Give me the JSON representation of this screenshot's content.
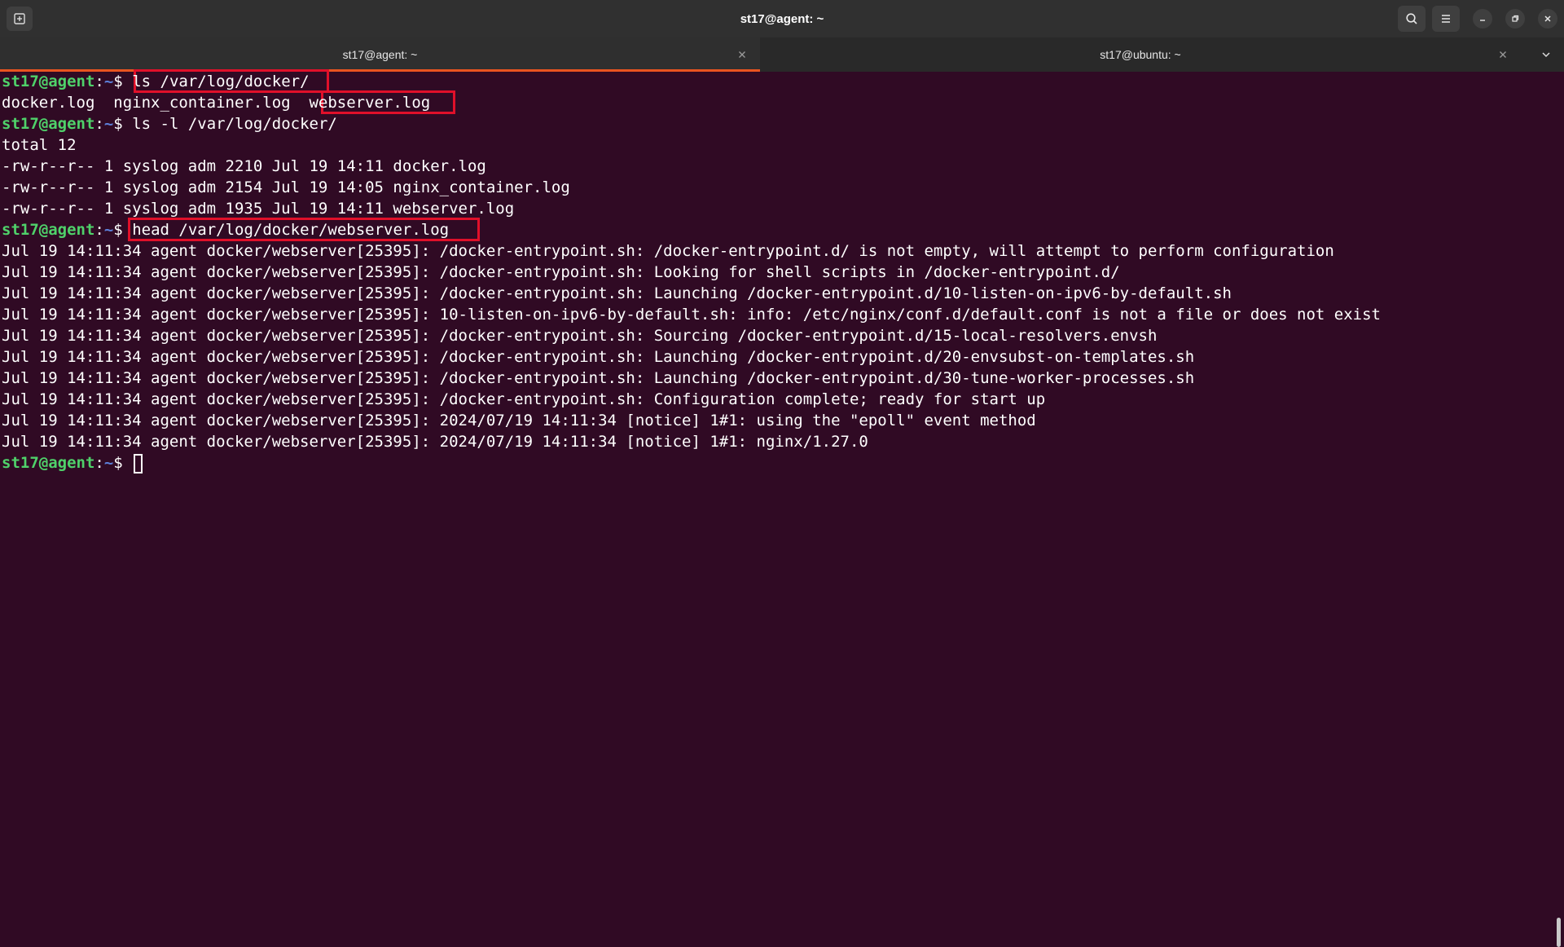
{
  "window": {
    "title": "st17@agent: ~"
  },
  "tabs": [
    {
      "label": "st17@agent: ~",
      "active": true
    },
    {
      "label": "st17@ubuntu: ~",
      "active": false
    }
  ],
  "prompt": {
    "user_host": "st17@agent",
    "sep": ":",
    "path": "~",
    "symbol": "$"
  },
  "lines": [
    {
      "type": "cmd",
      "text": " ls /var/log/docker/"
    },
    {
      "type": "out",
      "text": "docker.log  nginx_container.log  webserver.log"
    },
    {
      "type": "cmd",
      "text": " ls -l /var/log/docker/"
    },
    {
      "type": "out",
      "text": "total 12"
    },
    {
      "type": "out",
      "text": "-rw-r--r-- 1 syslog adm 2210 Jul 19 14:11 docker.log"
    },
    {
      "type": "out",
      "text": "-rw-r--r-- 1 syslog adm 2154 Jul 19 14:05 nginx_container.log"
    },
    {
      "type": "out",
      "text": "-rw-r--r-- 1 syslog adm 1935 Jul 19 14:11 webserver.log"
    },
    {
      "type": "cmd",
      "text": " head /var/log/docker/webserver.log"
    },
    {
      "type": "out",
      "text": "Jul 19 14:11:34 agent docker/webserver[25395]: /docker-entrypoint.sh: /docker-entrypoint.d/ is not empty, will attempt to perform configuration"
    },
    {
      "type": "out",
      "text": "Jul 19 14:11:34 agent docker/webserver[25395]: /docker-entrypoint.sh: Looking for shell scripts in /docker-entrypoint.d/"
    },
    {
      "type": "out",
      "text": "Jul 19 14:11:34 agent docker/webserver[25395]: /docker-entrypoint.sh: Launching /docker-entrypoint.d/10-listen-on-ipv6-by-default.sh"
    },
    {
      "type": "out",
      "text": "Jul 19 14:11:34 agent docker/webserver[25395]: 10-listen-on-ipv6-by-default.sh: info: /etc/nginx/conf.d/default.conf is not a file or does not exist"
    },
    {
      "type": "out",
      "text": "Jul 19 14:11:34 agent docker/webserver[25395]: /docker-entrypoint.sh: Sourcing /docker-entrypoint.d/15-local-resolvers.envsh"
    },
    {
      "type": "out",
      "text": "Jul 19 14:11:34 agent docker/webserver[25395]: /docker-entrypoint.sh: Launching /docker-entrypoint.d/20-envsubst-on-templates.sh"
    },
    {
      "type": "out",
      "text": "Jul 19 14:11:34 agent docker/webserver[25395]: /docker-entrypoint.sh: Launching /docker-entrypoint.d/30-tune-worker-processes.sh"
    },
    {
      "type": "out",
      "text": "Jul 19 14:11:34 agent docker/webserver[25395]: /docker-entrypoint.sh: Configuration complete; ready for start up"
    },
    {
      "type": "out",
      "text": "Jul 19 14:11:34 agent docker/webserver[25395]: 2024/07/19 14:11:34 [notice] 1#1: using the \"epoll\" event method"
    },
    {
      "type": "out",
      "text": "Jul 19 14:11:34 agent docker/webserver[25395]: 2024/07/19 14:11:34 [notice] 1#1: nginx/1.27.0"
    },
    {
      "type": "cmd",
      "text": " "
    }
  ],
  "colors": {
    "background": "#300a24",
    "prompt_user": "#4fd16a",
    "prompt_path": "#5c7fd8",
    "highlight_box": "#e0102a",
    "tab_accent": "#e95420"
  },
  "icons": {
    "new_tab": "new-tab-icon",
    "search": "search-icon",
    "menu": "hamburger-menu-icon",
    "minimize": "minimize-icon",
    "maximize": "maximize-icon",
    "close": "close-icon"
  }
}
